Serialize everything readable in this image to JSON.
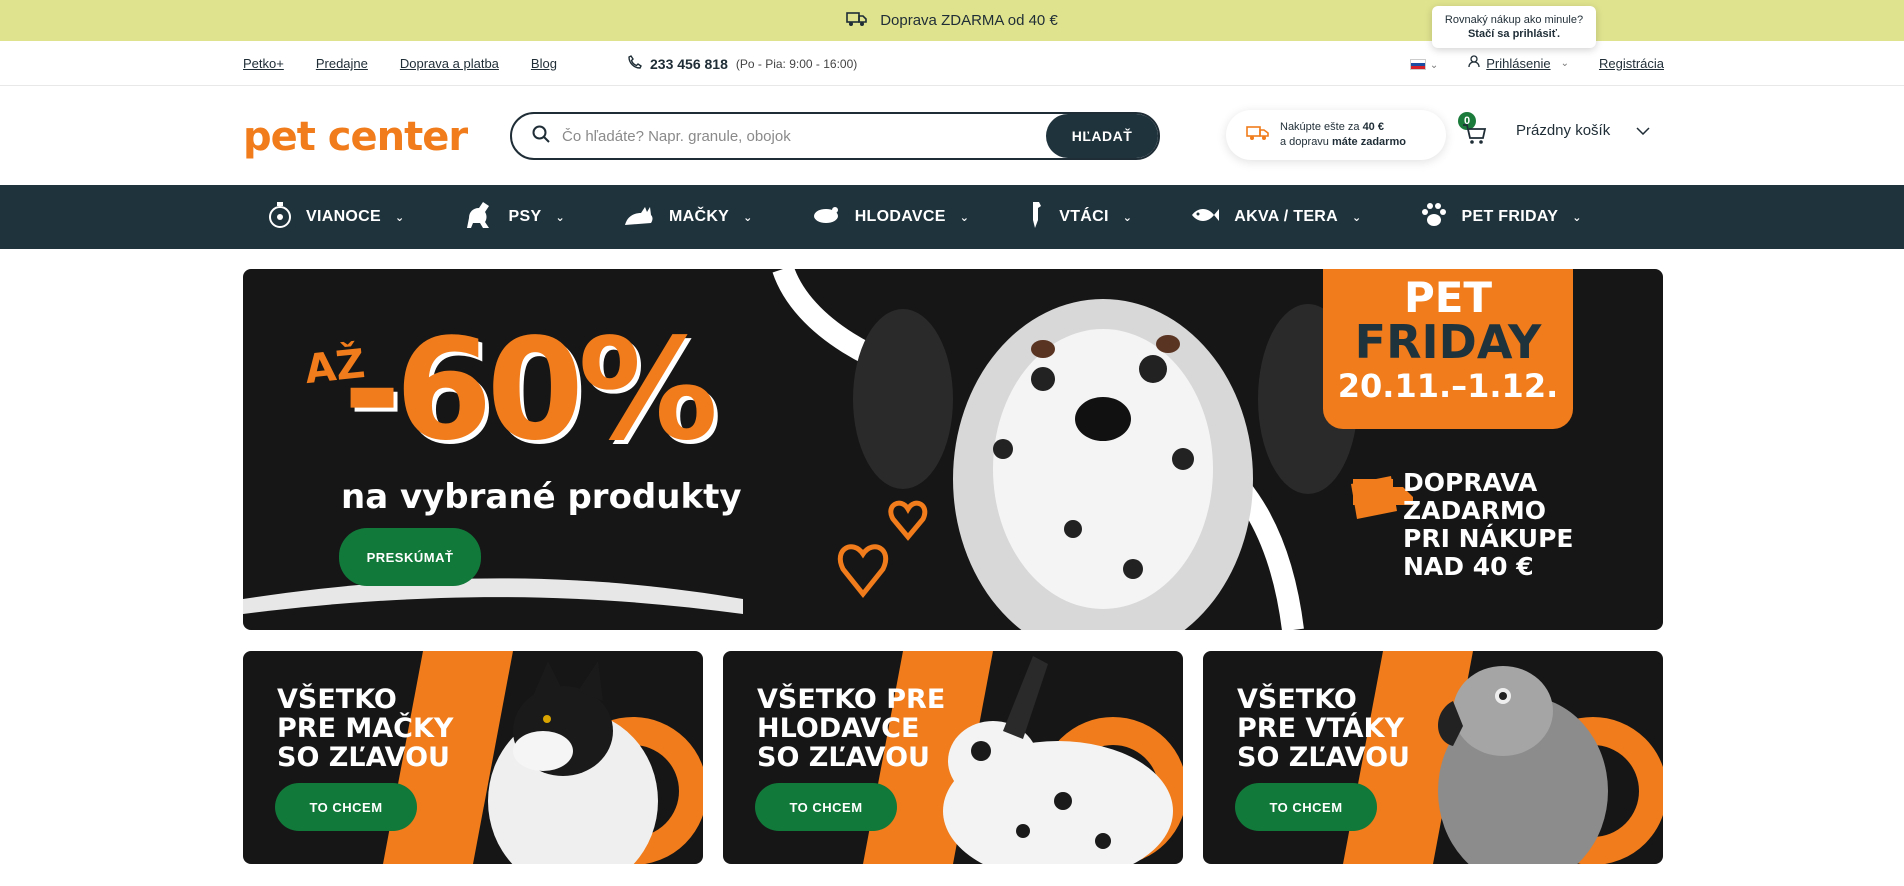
{
  "topbar": {
    "shipping_text": "Doprava ZDARMA od 40 €"
  },
  "tooltip": {
    "line1": "Rovnaký nákup ako minule?",
    "line2": "Stačí sa prihlásiť."
  },
  "util": {
    "links": [
      "Petko+",
      "Predajne",
      "Doprava a platba",
      "Blog"
    ],
    "phone": "233 456 818",
    "hours": "(Po - Pia: 9:00 - 16:00)",
    "login": "Prihlásenie",
    "register": "Registrácia"
  },
  "header": {
    "logo": "pet center",
    "search_placeholder": "Čo hľadáte? Napr. granule, obojok",
    "search_button": "HĽADAŤ",
    "freeship_line1_pre": "Nakúpte ešte za ",
    "freeship_amount": "40 €",
    "freeship_line2_pre": "a dopravu ",
    "freeship_line2_bold": "máte zadarmo",
    "cart_count": "0",
    "cart_label": "Prázdny košík"
  },
  "nav": {
    "items": [
      {
        "label": "VIANOCE",
        "icon": "ornament-icon"
      },
      {
        "label": "PSY",
        "icon": "dog-icon"
      },
      {
        "label": "MAČKY",
        "icon": "cat-icon"
      },
      {
        "label": "HLODAVCE",
        "icon": "rodent-icon"
      },
      {
        "label": "VTÁCI",
        "icon": "bird-icon"
      },
      {
        "label": "AKVA / TERA",
        "icon": "fish-icon"
      },
      {
        "label": "PET FRIDAY",
        "icon": "paw-icon"
      }
    ]
  },
  "hero": {
    "prefix": "AŽ",
    "discount": "-60%",
    "subtitle": "na vybrané produkty",
    "cta": "PRESKÚMAŤ",
    "badge_line1": "PET",
    "badge_line2": "FRIDAY",
    "badge_dates": "20.11.–1.12.",
    "shipping_lines": [
      "DOPRAVA",
      "ZADARMO",
      "PRI NÁKUPE",
      "NAD 40 €"
    ]
  },
  "promos": [
    {
      "lines": [
        "VŠETKO",
        "PRE MAČKY",
        "SO ZĽAVOU"
      ],
      "cta": "TO CHCEM"
    },
    {
      "lines": [
        "VŠETKO PRE",
        "HLODAVCE",
        "SO ZĽAVOU"
      ],
      "cta": "TO CHCEM"
    },
    {
      "lines": [
        "VŠETKO",
        "PRE VTÁKY",
        "SO ZĽAVOU"
      ],
      "cta": "TO CHCEM"
    }
  ],
  "colors": {
    "topbar": "#dfe38e",
    "nav": "#1f333d",
    "brand_orange": "#f07c1b",
    "green": "#11793a"
  }
}
